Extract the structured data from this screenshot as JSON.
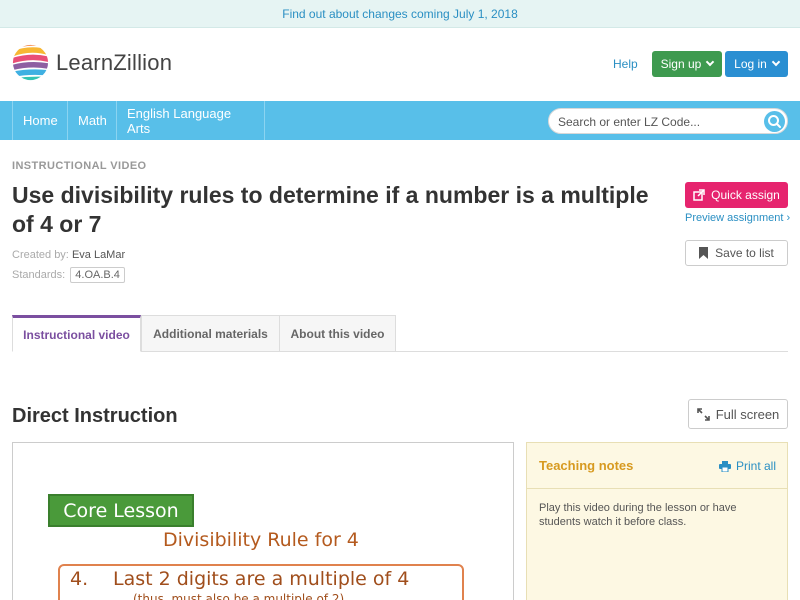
{
  "announcement": {
    "text": "Find out about changes coming July 1, 2018"
  },
  "header": {
    "logo_text": "LearnZillion",
    "help_label": "Help",
    "signup_label": "Sign up",
    "login_label": "Log in"
  },
  "nav": {
    "items": [
      {
        "label": "Home"
      },
      {
        "label": "Math"
      },
      {
        "label": "English Language Arts"
      }
    ],
    "search": {
      "placeholder": "Search or enter LZ Code..."
    }
  },
  "lesson": {
    "eyebrow": "INSTRUCTIONAL VIDEO",
    "title": "Use divisibility rules to determine if a number is a multiple of 4 or 7",
    "created_by_label": "Created by:",
    "author": "Eva LaMar",
    "standards_label": "Standards:",
    "standard": "4.OA.B.4"
  },
  "actions": {
    "quick_assign_label": "Quick assign",
    "preview_label": "Preview assignment ›",
    "save_label": "Save to list"
  },
  "tabs": [
    {
      "label": "Instructional video",
      "active": true
    },
    {
      "label": "Additional materials",
      "active": false
    },
    {
      "label": "About this video",
      "active": false
    }
  ],
  "section": {
    "title": "Direct Instruction",
    "fullscreen_label": "Full screen"
  },
  "video": {
    "core_lesson": "Core Lesson",
    "rule_title": "Divisibility Rule for 4",
    "rule_number": "4.",
    "rule_text": "Last 2 digits are a multiple of 4",
    "rule_subtext": "(thus, must also be a multiple of 2)"
  },
  "teaching_notes": {
    "title": "Teaching notes",
    "print_label": "Print all",
    "body": "Play this video during the lesson or have students watch it before class."
  },
  "colors": {
    "accent_blue": "#58bfe9",
    "signup_green": "#3e9a4f",
    "login_blue": "#2a8fd2",
    "quick_assign_pink": "#e6246e",
    "active_tab_purple": "#7b4fa0",
    "notes_gold": "#d79a20"
  },
  "icons": [
    "logo-mark-icon",
    "chevron-down-icon",
    "search-icon",
    "external-link-icon",
    "bookmark-icon",
    "expand-icon",
    "print-icon"
  ]
}
